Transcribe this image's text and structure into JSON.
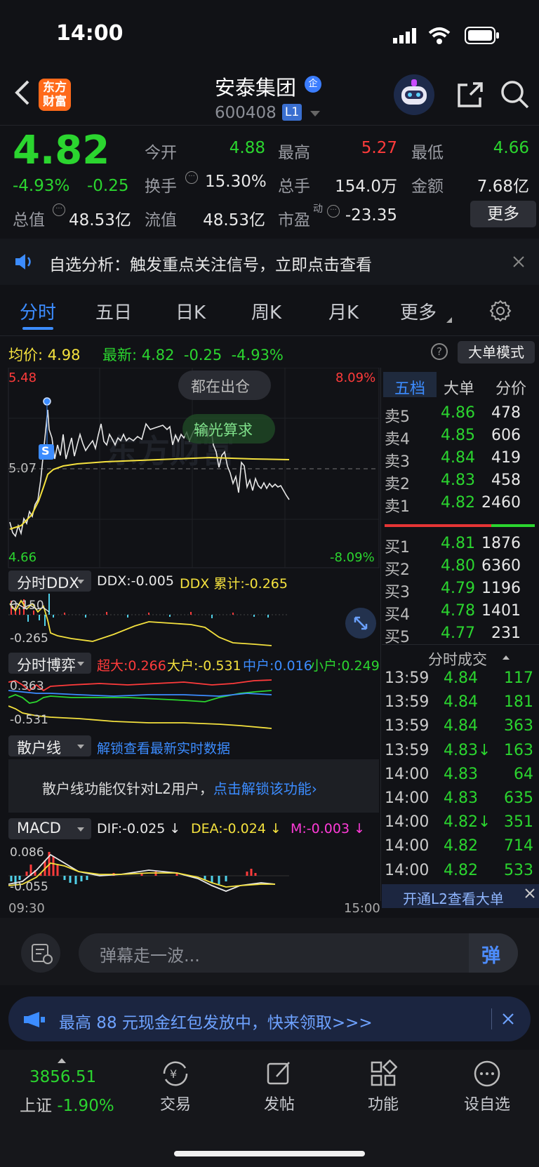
{
  "status": {
    "time": "14:00"
  },
  "header": {
    "logo_l1": "东方",
    "logo_l2": "财富",
    "name": "安泰集团",
    "name_badge": "企",
    "code": "600408",
    "level": "L1"
  },
  "quote": {
    "price": "4.82",
    "pct": "-4.93%",
    "chg": "-0.25",
    "open_label": "今开",
    "open": "4.88",
    "high_label": "最高",
    "high": "5.27",
    "low_label": "最低",
    "low": "4.66",
    "turnover_label": "换手",
    "turnover": "15.30%",
    "vol_label": "总手",
    "vol": "154.0万",
    "amt_label": "金额",
    "amt": "7.68亿",
    "mcap_label": "总值",
    "mcap": "48.53亿",
    "float_label": "流值",
    "float": "48.53亿",
    "pe_label": "市盈",
    "pe_sup": "动",
    "pe": "-23.35",
    "more": "更多"
  },
  "notice": {
    "text": "自选分析：触发重点关注信号，立即点击查看"
  },
  "tabs": [
    "分时",
    "五日",
    "日K",
    "周K",
    "月K",
    "更多"
  ],
  "info": {
    "avg_label": "均价:",
    "avg": "4.98",
    "last_label": "最新:",
    "last": "4.82",
    "chg": "-0.25",
    "pct": "-4.93%",
    "mode": "大单模式"
  },
  "chart": {
    "y_top": "5.48",
    "y_mid": "5.07",
    "y_bot": "4.66",
    "pct_top": "8.09%",
    "pct_bot": "-8.09%",
    "bubble1": "都在出仓",
    "bubble2": "输光算求",
    "s_marker": "S",
    "t_start": "09:30",
    "t_end": "15:00"
  },
  "ddx": {
    "label": "分时DDX",
    "ddx": "DDX:-0.005",
    "acc": "DDX 累计:-0.265",
    "top": "0.150",
    "bot": "-0.265"
  },
  "game": {
    "label": "分时博弈",
    "big": "超大:0.266",
    "large": "大户:-0.531",
    "mid": "中户:0.016",
    "small": "小户:0.249",
    "top": "0.363",
    "bot": "-0.531"
  },
  "retail": {
    "label": "散户线",
    "link": "解锁查看最新实时数据",
    "msg": "散户线功能仅针对L2用户，",
    "msg_link": "点击解锁该功能"
  },
  "macd": {
    "label": "MACD",
    "dif": "DIF:-0.025 ↓",
    "dea": "DEA:-0.024 ↓",
    "m": "M:-0.003 ↓",
    "top": "0.086",
    "bot": "-0.055"
  },
  "book": {
    "tabs": [
      "五档",
      "大单",
      "分价"
    ],
    "asks": [
      {
        "l": "卖5",
        "p": "4.86",
        "v": "478"
      },
      {
        "l": "卖4",
        "p": "4.85",
        "v": "606"
      },
      {
        "l": "卖3",
        "p": "4.84",
        "v": "419"
      },
      {
        "l": "卖2",
        "p": "4.83",
        "v": "458"
      },
      {
        "l": "卖1",
        "p": "4.82",
        "v": "2460"
      }
    ],
    "bids": [
      {
        "l": "买1",
        "p": "4.81",
        "v": "1876"
      },
      {
        "l": "买2",
        "p": "4.80",
        "v": "6360"
      },
      {
        "l": "买3",
        "p": "4.79",
        "v": "1196"
      },
      {
        "l": "买4",
        "p": "4.78",
        "v": "1401"
      },
      {
        "l": "买5",
        "p": "4.77",
        "v": "231"
      }
    ]
  },
  "trades": {
    "title": "分时成交",
    "rows": [
      {
        "t": "13:59",
        "p": "4.84",
        "v": "117"
      },
      {
        "t": "13:59",
        "p": "4.84",
        "v": "181"
      },
      {
        "t": "13:59",
        "p": "4.84",
        "v": "363"
      },
      {
        "t": "13:59",
        "p": "4.83↓",
        "v": "163"
      },
      {
        "t": "14:00",
        "p": "4.83",
        "v": "64"
      },
      {
        "t": "14:00",
        "p": "4.83",
        "v": "635"
      },
      {
        "t": "14:00",
        "p": "4.82↓",
        "v": "351"
      },
      {
        "t": "14:00",
        "p": "4.82",
        "v": "714"
      },
      {
        "t": "14:00",
        "p": "4.82",
        "v": "533"
      }
    ],
    "l2": "开通L2查看大单"
  },
  "comment": {
    "placeholder": "弹幕走一波...",
    "btn": "弹"
  },
  "promo": {
    "text": "最高 88 元现金红包发放中，快来领取>>>"
  },
  "bottom": {
    "index_val": "3856.51",
    "index_name": "上证",
    "index_pct": "-1.90%",
    "items": [
      "交易",
      "发帖",
      "功能",
      "设自选"
    ]
  }
}
